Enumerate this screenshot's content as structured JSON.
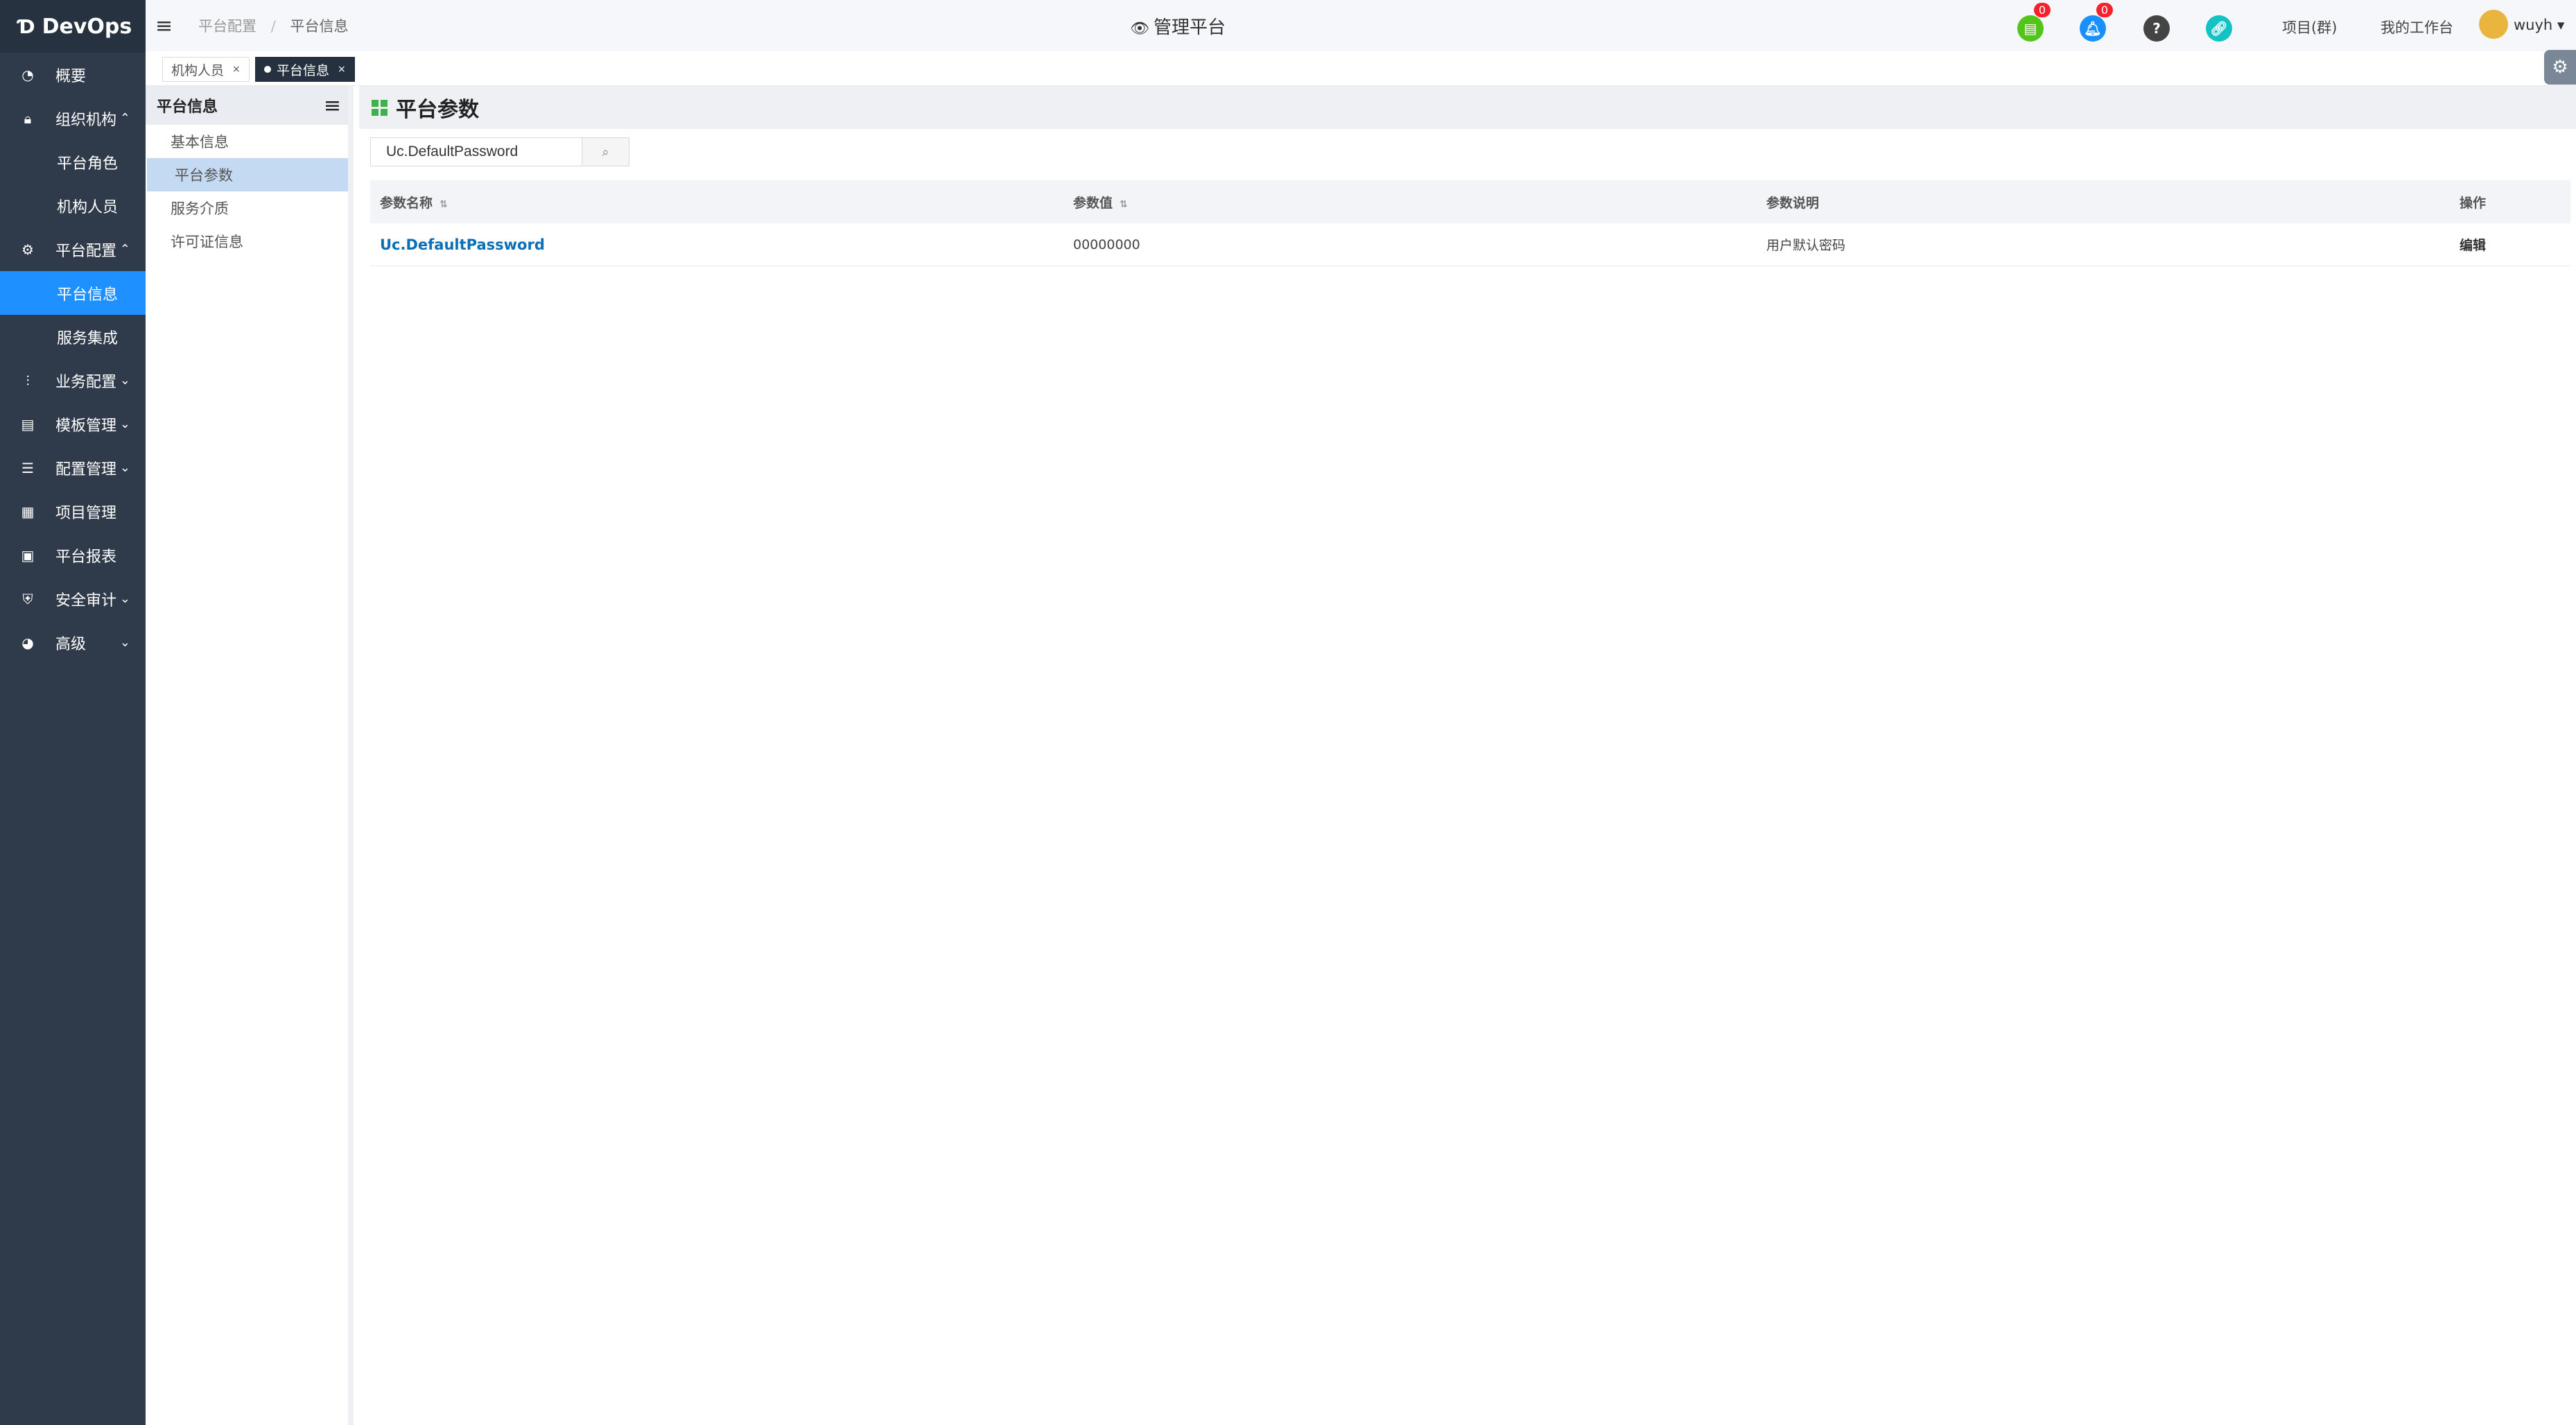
{
  "app": {
    "title": "DevOps"
  },
  "sidebar": {
    "items": [
      {
        "label": "概要"
      },
      {
        "label": "组织机构"
      },
      {
        "label": "平台角色"
      },
      {
        "label": "机构人员"
      },
      {
        "label": "平台配置"
      },
      {
        "label": "平台信息"
      },
      {
        "label": "服务集成"
      },
      {
        "label": "业务配置"
      },
      {
        "label": "模板管理"
      },
      {
        "label": "配置管理"
      },
      {
        "label": "项目管理"
      },
      {
        "label": "平台报表"
      },
      {
        "label": "安全审计"
      },
      {
        "label": "高级"
      }
    ]
  },
  "header": {
    "breadcrumb": [
      "平台配置",
      "平台信息"
    ],
    "title": "管理平台",
    "doc_badge": "0",
    "bell_badge": "0",
    "project_link": "项目(群)",
    "workspace_link": "我的工作台",
    "user": "wuyh"
  },
  "tabs": [
    {
      "label": "机构人员"
    },
    {
      "label": "平台信息"
    }
  ],
  "submenu": {
    "title": "平台信息",
    "items": [
      "基本信息",
      "平台参数",
      "服务介质",
      "许可证信息"
    ]
  },
  "main": {
    "title": "平台参数",
    "search_value": "Uc.DefaultPassword",
    "table": {
      "headers": [
        "参数名称",
        "参数值",
        "参数说明",
        "操作"
      ],
      "rows": [
        {
          "name": "Uc.DefaultPassword",
          "value": "00000000",
          "desc": "用户默认密码",
          "action": "编辑"
        }
      ]
    }
  },
  "colors": {
    "sidebar_bg": "#2f3a4a",
    "active": "#1e90ff",
    "link": "#0b6fb8"
  }
}
